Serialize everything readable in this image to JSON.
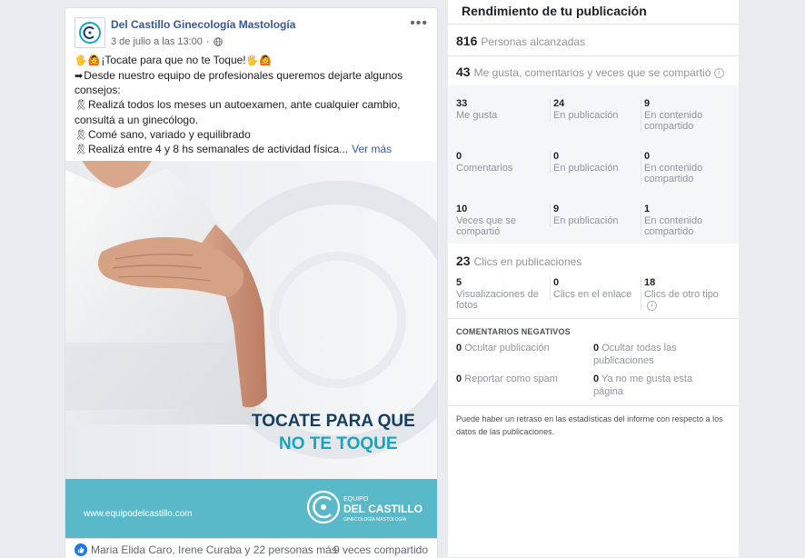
{
  "post": {
    "page_name": "Del Castillo Ginecología Mastología",
    "date": "3 de julio a las 13:00",
    "privacy_icon": "globe-icon",
    "lines": [
      {
        "emoji": [
          "🖐",
          "🙆"
        ],
        "text": "¡Tocate para que no te Toque!",
        "trail": [
          "🖐",
          "🙆"
        ]
      },
      {
        "emoji": [
          "➡"
        ],
        "text": "Desde nuestro equipo de profesionales queremos dejarte algunos"
      },
      {
        "emoji": [],
        "text": "consejos:"
      },
      {
        "emoji": [
          "🎗"
        ],
        "text": "Realizá todos los meses un autoexamen, ante cualquier cambio,"
      },
      {
        "emoji": [],
        "text": "consultá a un ginecólogo."
      },
      {
        "emoji": [
          "🎗"
        ],
        "text": "Comé sano, variado y equilibrado"
      },
      {
        "emoji": [
          "🎗"
        ],
        "text": "Realizá entre 4 y 8 hs semanales de actividad física..."
      }
    ],
    "see_more": "Ver más",
    "image": {
      "headline_line1": "TOCATE PARA QUE",
      "headline_line2": "NO TE TOQUE",
      "website": "www.equipodelcastillo.com",
      "logo_line1": "EQUIPO",
      "logo_line2": "DEL CASTILLO",
      "logo_line3": "GINECOLOGÍA  MASTOLOGÍA"
    },
    "reactions_text": "Maria Elida Caro, Irene Curaba y 22 personas más",
    "shares_text": "9 veces compartido"
  },
  "panel": {
    "title": "Rendimiento de tu publicación",
    "reach_value": "816",
    "reach_label": "Personas alcanzadas",
    "engagement_value": "43",
    "engagement_label": "Me gusta, comentarios y veces que se compartió",
    "stats": [
      [
        {
          "n": "33",
          "label": "Me gusta"
        },
        {
          "n": "24",
          "label": "En publicación"
        },
        {
          "n": "9",
          "label": "En contenido compartido"
        }
      ],
      [
        {
          "n": "0",
          "label": "Comentarios"
        },
        {
          "n": "0",
          "label": "En publicación"
        },
        {
          "n": "0",
          "label": "En contenido compartido"
        }
      ],
      [
        {
          "n": "10",
          "label": "Veces que se compartió"
        },
        {
          "n": "9",
          "label": "En publicación"
        },
        {
          "n": "1",
          "label": "En contenido compartido"
        }
      ]
    ],
    "clicks_value": "23",
    "clicks_label": "Clics en publicaciones",
    "click_stats": [
      {
        "n": "5",
        "label": "Visualizaciones de fotos"
      },
      {
        "n": "0",
        "label": "Clics en el enlace"
      },
      {
        "n": "18",
        "label": "Clics de otro tipo"
      }
    ],
    "negative_title": "COMENTARIOS NEGATIVOS",
    "negative": [
      {
        "n": "0",
        "label": "Ocultar publicación"
      },
      {
        "n": "0",
        "label": "Ocultar todas las publicaciones"
      },
      {
        "n": "0",
        "label": "Reportar como spam"
      },
      {
        "n": "0",
        "label": "Ya no me gusta esta página"
      }
    ],
    "disclaimer": "Puede haber un retraso en las estadísticas del informe con respecto a los datos de las publicaciones."
  },
  "colors": {
    "link": "#385898",
    "teal": "#1aa3bd",
    "navy": "#163e62",
    "banner": "#5ab9c9"
  }
}
